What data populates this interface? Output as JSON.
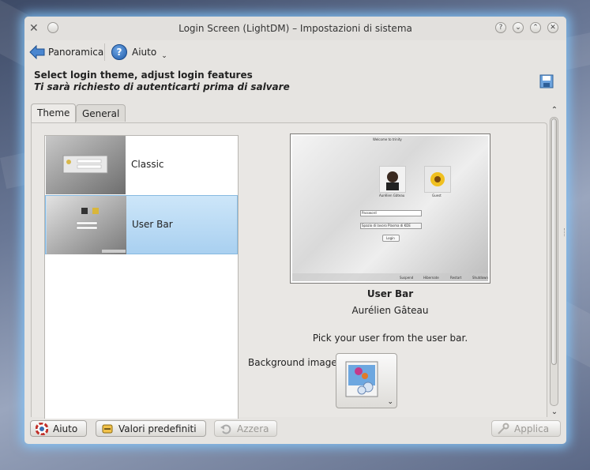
{
  "window": {
    "title": "Login Screen (LightDM) – Impostazioni di sistema",
    "titlebar_buttons": [
      "?",
      "⌄",
      "⌃",
      "✕"
    ]
  },
  "toolbar": {
    "overview_label": "Panoramica",
    "help_label": "Aiuto",
    "help_menu_glyph": "⌄"
  },
  "header": {
    "title": "Select login theme, adjust login features",
    "subtitle": "Ti sarà richiesto di autenticarti prima di salvare"
  },
  "tabs": [
    {
      "label": "Theme",
      "active": true
    },
    {
      "label": "General",
      "active": false
    }
  ],
  "themes": [
    {
      "name": "Classic",
      "selected": false
    },
    {
      "name": "User Bar",
      "selected": true
    }
  ],
  "preview": {
    "welcome": "Welcome to trinity",
    "user1": "Aurélien Gâteau",
    "user2": "Guest",
    "password_placeholder": "Password",
    "session": "Spazio di lavoro Plasma di KDE",
    "login_button": "Login",
    "bottom_items": [
      "Suspend",
      "Hibernate",
      "Restart",
      "Shutdown"
    ]
  },
  "theme_info": {
    "name": "User Bar",
    "author": "Aurélien Gâteau",
    "description": "Pick your user from the user bar."
  },
  "background": {
    "label": "Background image:"
  },
  "buttons": {
    "help": "Aiuto",
    "defaults": "Valori predefiniti",
    "reset": "Azzera",
    "apply": "Applica"
  },
  "colors": {
    "selection": "#a9d0f0",
    "glow": "#82c8ff",
    "help_icon": "#1f5ba8"
  }
}
